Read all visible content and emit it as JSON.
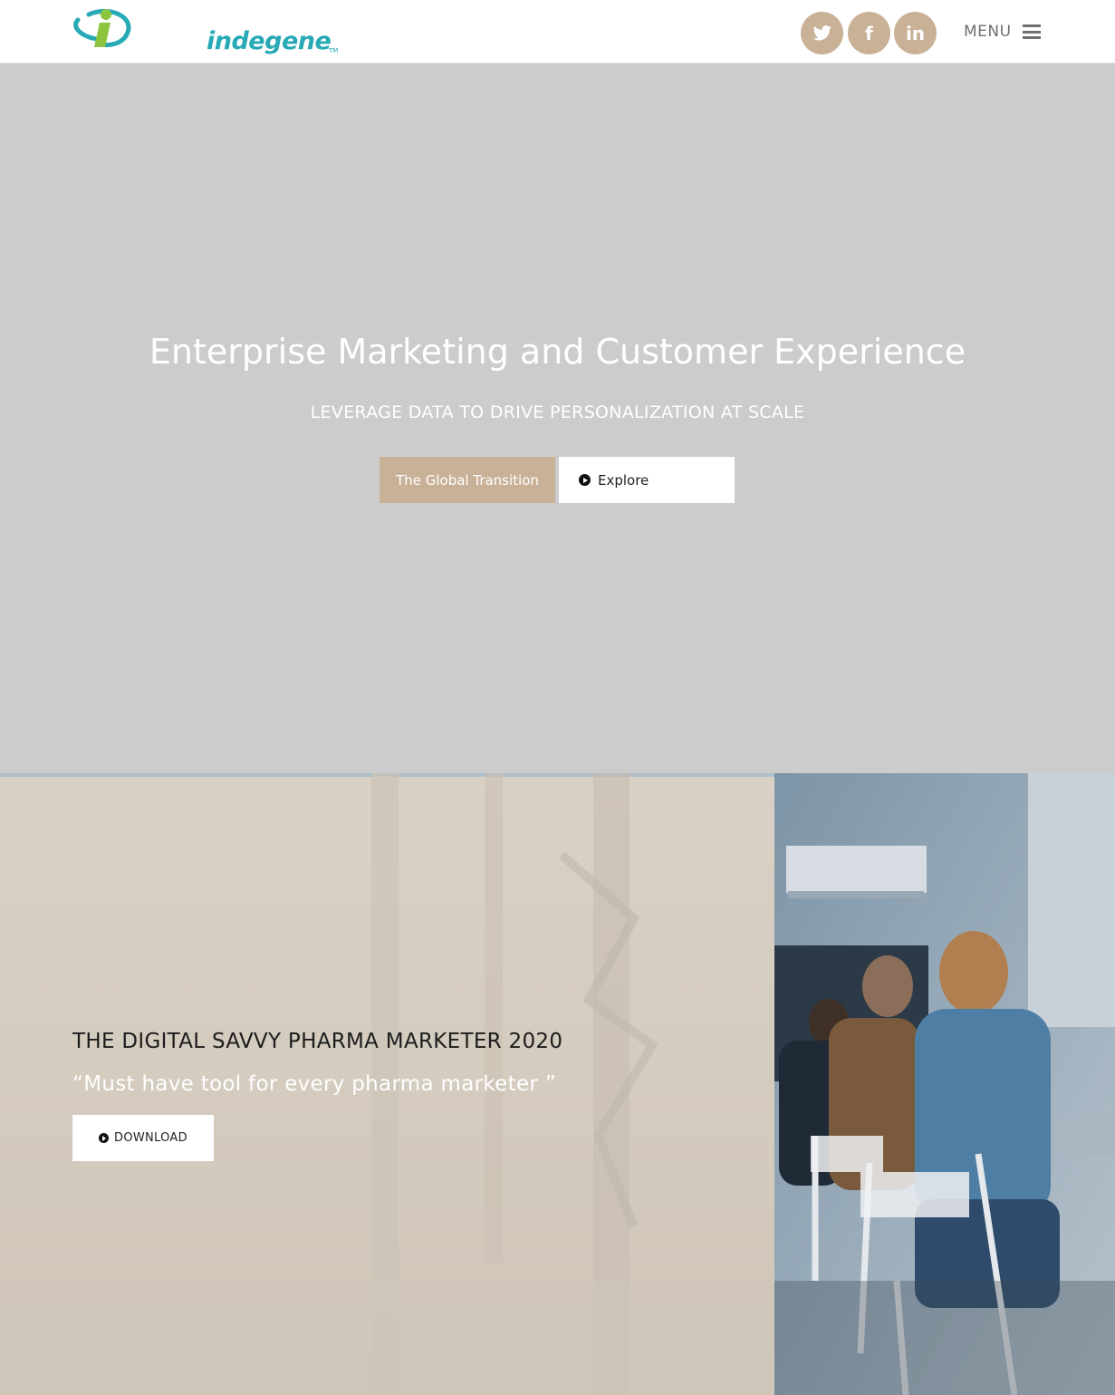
{
  "header": {
    "logo_text": "indegene",
    "logo_tm": "TM",
    "social": [
      {
        "name": "twitter",
        "icon": "twitter-icon"
      },
      {
        "name": "facebook",
        "icon": "facebook-icon",
        "glyph": "f"
      },
      {
        "name": "linkedin",
        "icon": "linkedin-icon",
        "glyph": "in"
      }
    ],
    "menu_label": "MENU"
  },
  "hero": {
    "title": "Enterprise Marketing and Customer Experience",
    "subtitle": "LEVERAGE DATA TO DRIVE PERSONALIZATION AT SCALE",
    "primary_button": "The Global Transition",
    "secondary_button": "Explore"
  },
  "feature": {
    "title": "THE DIGITAL SAVVY PHARMA MARKETER 2020",
    "quote": "“Must have tool for every pharma marketer ”",
    "button": "DOWNLOAD"
  },
  "colors": {
    "accent": "#c9b197",
    "logo_teal": "#27a9b6",
    "logo_green": "#8cc43f",
    "hero_bg": "#cccccc"
  }
}
